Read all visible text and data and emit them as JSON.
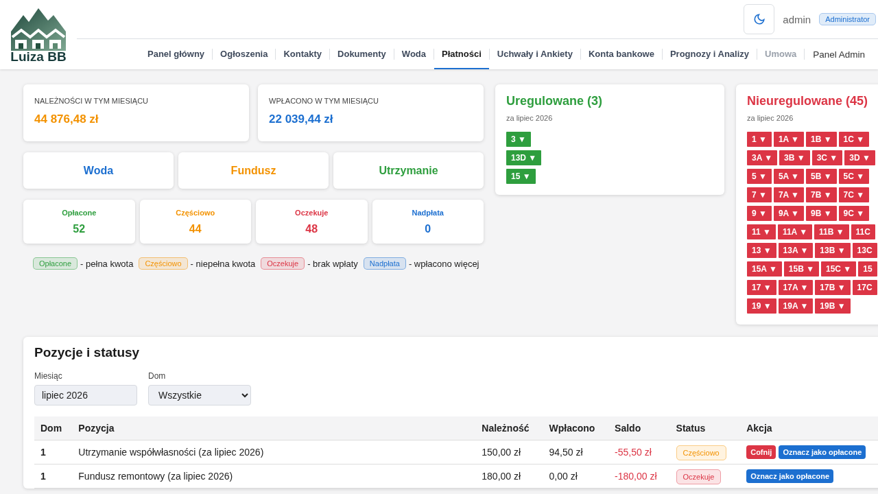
{
  "brand": {
    "name": "Luiza BB"
  },
  "user": {
    "name": "admin",
    "role": "Administrator"
  },
  "nav": [
    {
      "label": "Panel główny",
      "selected": false,
      "disabled": false
    },
    {
      "label": "Ogłoszenia",
      "selected": false,
      "disabled": false
    },
    {
      "label": "Kontakty",
      "selected": false,
      "disabled": false
    },
    {
      "label": "Dokumenty",
      "selected": false,
      "disabled": false
    },
    {
      "label": "Woda",
      "selected": false,
      "disabled": false
    },
    {
      "label": "Płatności",
      "selected": true,
      "disabled": false
    },
    {
      "label": "Uchwały i Ankiety",
      "selected": false,
      "disabled": false
    },
    {
      "label": "Konta bankowe",
      "selected": false,
      "disabled": false
    },
    {
      "label": "Prognozy i Analizy",
      "selected": false,
      "disabled": false
    },
    {
      "label": "Umowa",
      "selected": false,
      "disabled": true
    }
  ],
  "admin_link": "Panel Admin",
  "summary": [
    {
      "label": "NALEŻNOŚCI W TYM MIESIĄCU",
      "value": "44 876,48 zł",
      "color": "#f39200"
    },
    {
      "label": "WPŁACONO W TYM MIESIĄCU",
      "value": "22 039,44 zł",
      "color": "#1c6fd0"
    }
  ],
  "categories": [
    {
      "label": "Woda",
      "color": "#1c6fd0"
    },
    {
      "label": "Fundusz",
      "color": "#f39200"
    },
    {
      "label": "Utrzymanie",
      "color": "#2e9e3e"
    }
  ],
  "counts": [
    {
      "label": "Opłacone",
      "value": "52",
      "color": "#2e9e3e"
    },
    {
      "label": "Częściowo",
      "value": "44",
      "color": "#f39200"
    },
    {
      "label": "Oczekuje",
      "value": "48",
      "color": "#dc3545"
    },
    {
      "label": "Nadpłata",
      "value": "0",
      "color": "#1c6fd0"
    }
  ],
  "legend": [
    {
      "badge": "Opłacone",
      "text": "- pełna kwota",
      "color": "#2e9e3e"
    },
    {
      "badge": "Częściowo",
      "text": "- niepełna kwota",
      "color": "#f39200"
    },
    {
      "badge": "Oczekuje",
      "text": "- brak wpłaty",
      "color": "#dc3545"
    },
    {
      "badge": "Nadpłata",
      "text": "- wpłacono więcej",
      "color": "#1c6fd0"
    }
  ],
  "settled": {
    "title": "Uregulowane (3)",
    "subtitle": "za lipiec 2026",
    "chips": [
      "3 ▼",
      "13D ▼",
      "15 ▼"
    ]
  },
  "unsettled": {
    "title": "Nieuregulowane (45)",
    "subtitle": "za lipiec 2026",
    "rows": [
      [
        "1 ▼",
        "1A ▼",
        "1B ▼",
        "1C ▼"
      ],
      [
        "3A ▼",
        "3B ▼",
        "3C ▼",
        "3D ▼"
      ],
      [
        "5 ▼",
        "5A ▼",
        "5B ▼",
        "5C ▼"
      ],
      [
        "7 ▼",
        "7A ▼",
        "7B ▼",
        "7C ▼"
      ],
      [
        "9 ▼",
        "9A ▼",
        "9B ▼",
        "9C ▼"
      ],
      [
        "11 ▼",
        "11A ▼",
        "11B ▼",
        "11C"
      ],
      [
        "13 ▼",
        "13A ▼",
        "13B ▼",
        "13C"
      ],
      [
        "15A ▼",
        "15B ▼",
        "15C ▼",
        "15"
      ],
      [
        "17 ▼",
        "17A ▼",
        "17B ▼",
        "17C"
      ],
      [
        "19 ▼",
        "19A ▼",
        "19B ▼"
      ]
    ]
  },
  "positions": {
    "title": "Pozycje i statusy",
    "month": {
      "label": "Miesiąc",
      "value": "lipiec 2026"
    },
    "house": {
      "label": "Dom",
      "value": "Wszystkie"
    },
    "columns": [
      "Dom",
      "Pozycja",
      "Należność",
      "Wpłacono",
      "Saldo",
      "Status",
      "Akcja"
    ],
    "rows": [
      {
        "dom": "1",
        "item": "Utrzymanie współwłasności (za lipiec 2026)",
        "due": "150,00 zł",
        "paid": "94,50 zł",
        "balance": "-55,50 zł",
        "status": {
          "kind": "partial",
          "label": "Częściowo"
        },
        "actions": [
          {
            "kind": "undo",
            "label": "Cofnij"
          },
          {
            "kind": "mark",
            "label": "Oznacz jako opłacone"
          }
        ]
      },
      {
        "dom": "1",
        "item": "Fundusz remontowy (za lipiec 2026)",
        "due": "180,00 zł",
        "paid": "0,00 zł",
        "balance": "-180,00 zł",
        "status": {
          "kind": "pending",
          "label": "Oczekuje"
        },
        "actions": [
          {
            "kind": "mark",
            "label": "Oznacz jako opłacone"
          }
        ]
      }
    ]
  }
}
